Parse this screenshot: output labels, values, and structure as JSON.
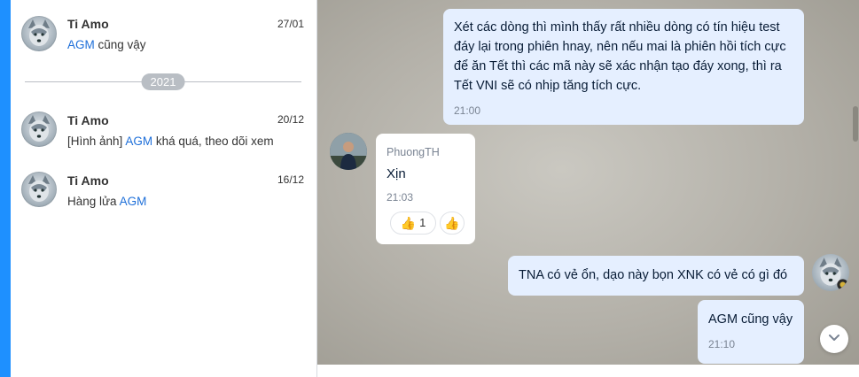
{
  "conversations": [
    {
      "name": "Ti Amo",
      "date": "27/01",
      "pre": "",
      "keyword": "AGM",
      "post": " cũng vậy"
    },
    {
      "name": "Ti Amo",
      "date": "20/12",
      "pre": "[Hình ảnh] ",
      "keyword": "AGM",
      "post": " khá quá, theo dõi xem"
    },
    {
      "name": "Ti Amo",
      "date": "16/12",
      "pre": "Hàng lửa ",
      "keyword": "AGM",
      "post": ""
    }
  ],
  "year_divider": "2021",
  "messages": [
    {
      "text": "Xét các dòng thì mình thấy rất nhiều dòng có tín hiệu test đáy lại trong phiên hnay, nên nếu mai là phiên hồi tích cực để ăn Tết thì các mã này sẽ xác nhận tạo đáy xong, thì ra Tết VNI sẽ có nhịp tăng tích cực.",
      "time": "21:00"
    },
    {
      "sender": "PhuongTH",
      "text": "Xịn",
      "time": "21:03",
      "reaction_count": "1"
    },
    {
      "text": "TNA có vẻ ổn, dạo này bọn XNK có vẻ có gì đó"
    },
    {
      "text": "AGM cũng vậy",
      "time": "21:10"
    }
  ],
  "icons": {
    "contact_avatar": "husky-dog-avatar",
    "sender_avatar": "person-avatar",
    "reaction": "thumbs-up-icon",
    "scroll_down": "chevron-down-icon"
  },
  "colors": {
    "accent": "#1e90ff",
    "keyword": "#1e6fd9",
    "own_bubble": "#e5efff"
  }
}
